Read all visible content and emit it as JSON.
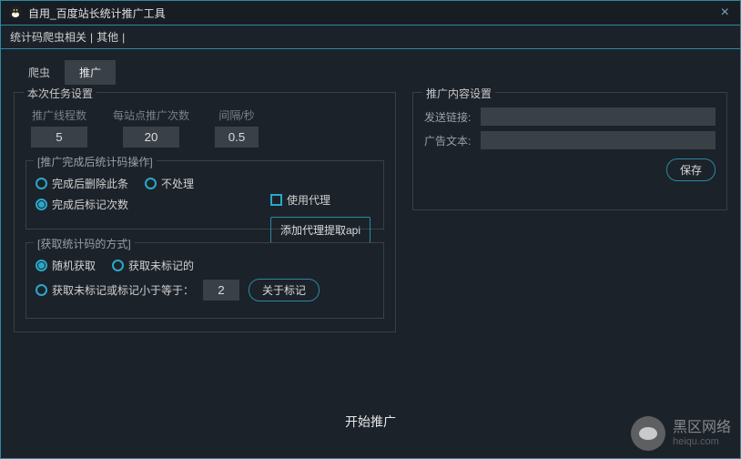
{
  "window": {
    "title": "自用_百度站长统计推广工具"
  },
  "menu": {
    "item1": "统计码爬虫相关",
    "item2": "其他",
    "sep": "|"
  },
  "tabs": {
    "crawler": "爬虫",
    "promo": "推广"
  },
  "task": {
    "legend": "本次任务设置",
    "threads_label": "推广线程数",
    "threads": "5",
    "perSite_label": "每站点推广次数",
    "perSite": "20",
    "interval_label": "间隔/秒",
    "interval": "0.5"
  },
  "ops": {
    "legend": "[推广完成后统计码操作]",
    "delete": "完成后删除此条",
    "noop": "不处理",
    "mark": "完成后标记次数"
  },
  "proxy": {
    "use": "使用代理",
    "addApi": "添加代理提取api"
  },
  "fetch": {
    "legend": "[获取统计码的方式]",
    "random": "随机获取",
    "unmarked": "获取未标记的",
    "lessThan": "获取未标记或标记小于等于：",
    "value": "2",
    "about": "关于标记"
  },
  "contentSet": {
    "legend": "推广内容设置",
    "link_label": "发送链接:",
    "link": "",
    "ad_label": "广告文本:",
    "ad": "",
    "save": "保存"
  },
  "footer": {
    "start": "开始推广"
  },
  "watermark": {
    "name": "黑区网络",
    "url": "heiqu.com"
  }
}
